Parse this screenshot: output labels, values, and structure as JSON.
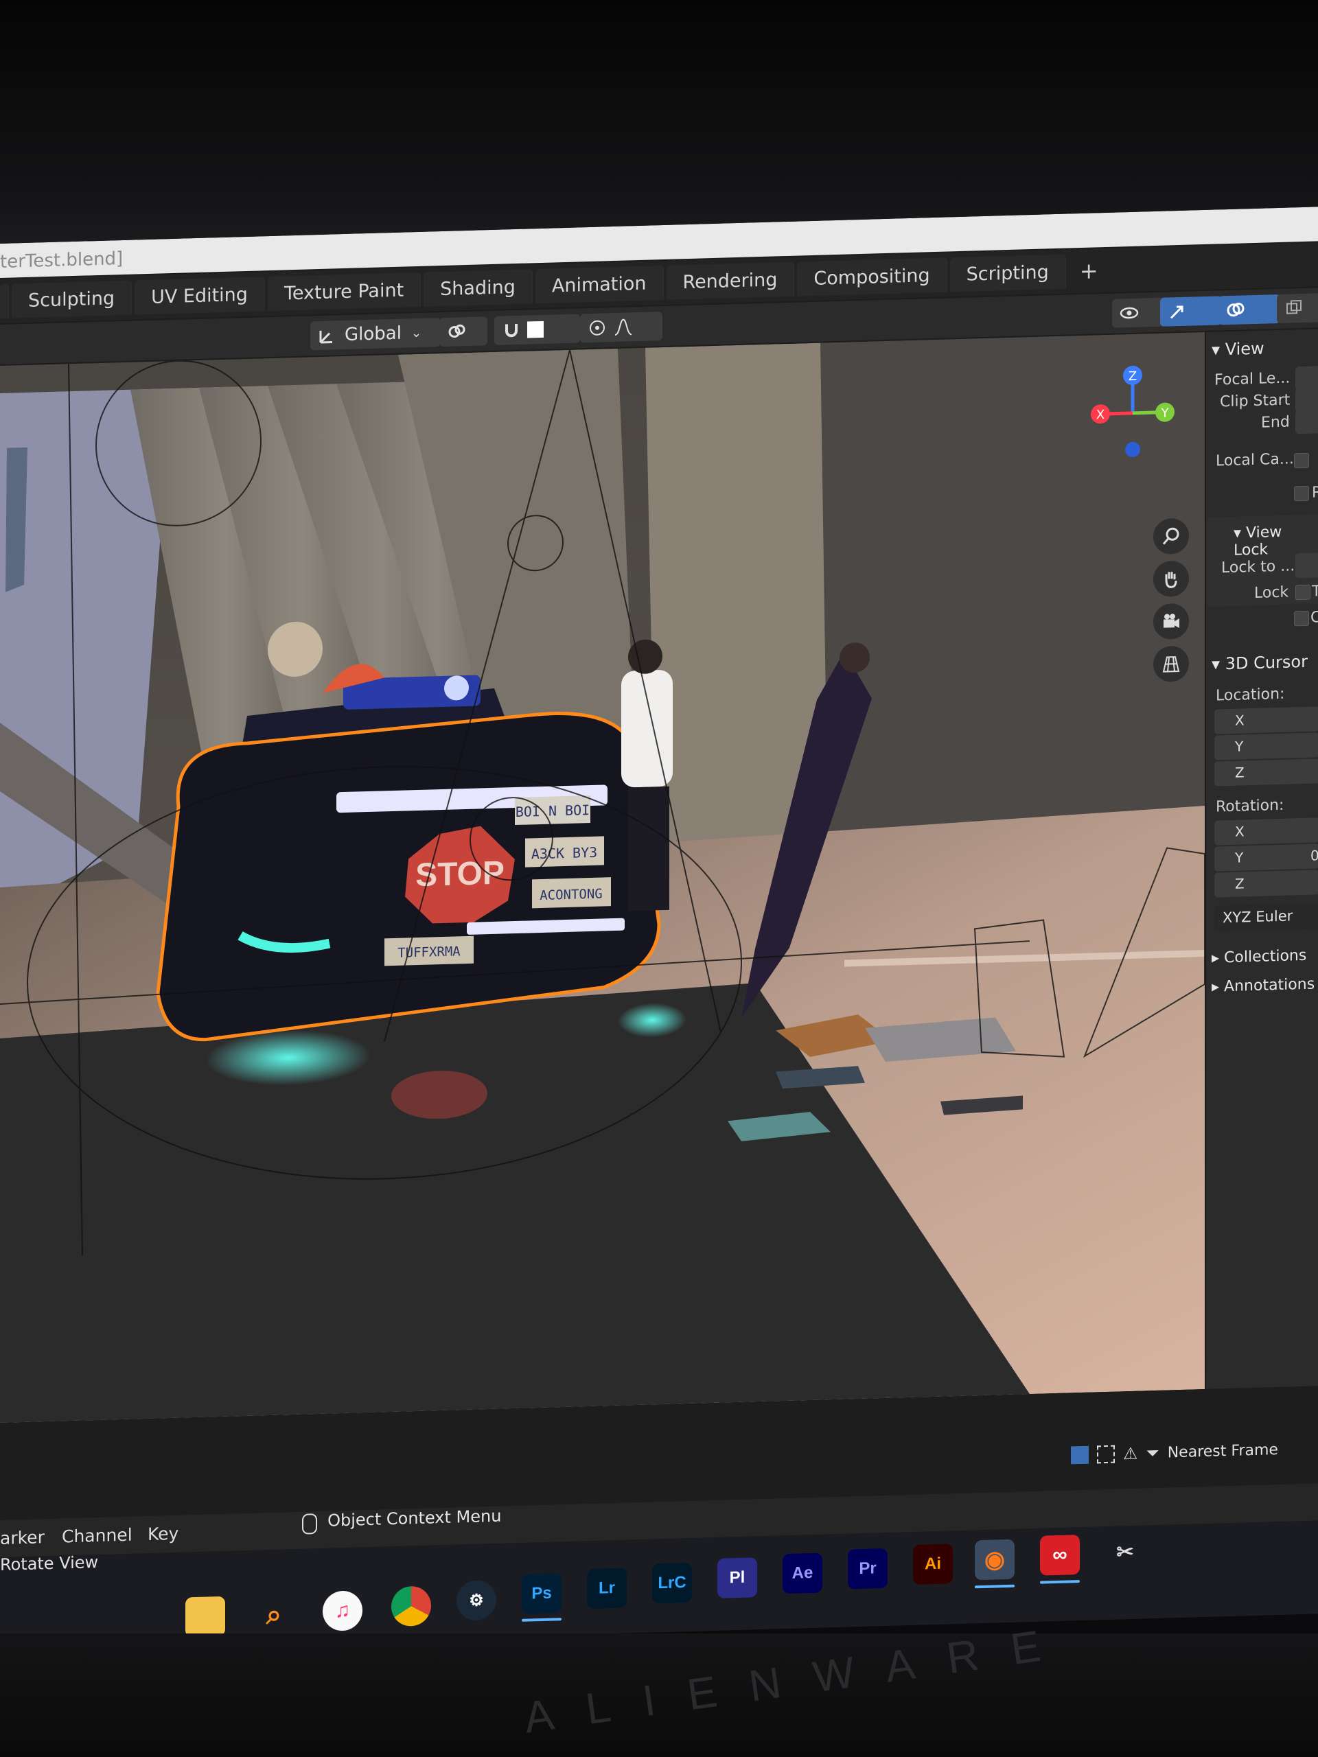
{
  "window": {
    "title_fragment": "terTest.blend]"
  },
  "workspace_tabs": [
    {
      "label": "Sculpting"
    },
    {
      "label": "UV Editing"
    },
    {
      "label": "Texture Paint"
    },
    {
      "label": "Shading"
    },
    {
      "label": "Animation"
    },
    {
      "label": "Rendering"
    },
    {
      "label": "Compositing"
    },
    {
      "label": "Scripting"
    }
  ],
  "header": {
    "transform_orientation": "Global",
    "add_tab_symbol": "+"
  },
  "gizmo_axes": {
    "z": "Z",
    "y": "Y",
    "x": "X"
  },
  "sidebar": {
    "view_panel": {
      "title": "View",
      "focal_length": "Focal Le...",
      "clip_start": "Clip Start",
      "clip_end": "End",
      "local_camera": "Local Ca...",
      "r_label": "R"
    },
    "view_lock_panel": {
      "title": "View Lock",
      "lock_to": "Lock to ...",
      "lock": "Lock",
      "t_label": "T",
      "c_label": "C"
    },
    "cursor_panel": {
      "title": "3D Cursor",
      "location": "Location:",
      "rotation": "Rotation:",
      "axes": [
        "X",
        "Y",
        "Z"
      ],
      "rotation_mode": "XYZ Euler",
      "rot_y_fragment": "0"
    },
    "collections": "Collections",
    "annotations": "Annotations"
  },
  "status": {
    "snap_mode": "Nearest Frame"
  },
  "timeline": {
    "marker": "arker",
    "channel": "Channel",
    "key": "Key",
    "context_menu": "Object Context Menu",
    "rotate_view": "Rotate View"
  },
  "scene_signs": {
    "stop": "STOP",
    "plate1": "BOI N BOI",
    "plate2": "A3CK BY3",
    "plate3": "ACONTONG",
    "plate4": "TUFFXRMA"
  },
  "taskbar": {
    "apps": [
      {
        "label": "Ps",
        "color": "#31a8ff",
        "bg": "#001e36"
      },
      {
        "label": "Lr",
        "color": "#31a8ff",
        "bg": "#001a2b"
      },
      {
        "label": "LrC",
        "color": "#31a8ff",
        "bg": "#001a2b"
      },
      {
        "label": "Pl",
        "color": "#ffffff",
        "bg": "#2c2c8a"
      },
      {
        "label": "Ae",
        "color": "#9999ff",
        "bg": "#00005b"
      },
      {
        "label": "Pr",
        "color": "#9999ff",
        "bg": "#00005b"
      },
      {
        "label": "Ai",
        "color": "#ff9a00",
        "bg": "#330000"
      }
    ],
    "accent_color": "#5fb6ff"
  },
  "brand": "ALIENWARE"
}
